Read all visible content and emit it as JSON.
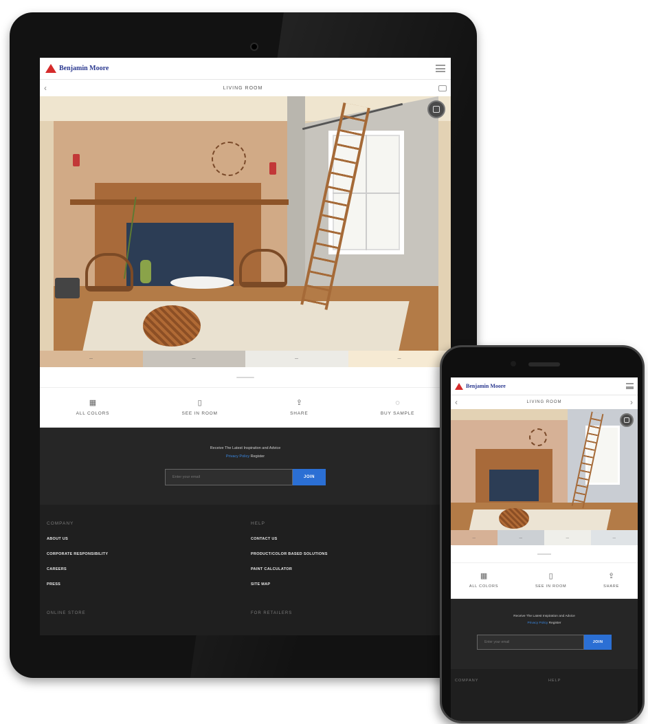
{
  "brand": {
    "name": "Benjamin Moore",
    "logo_color": "#d52b2b",
    "text_color": "#2b3990"
  },
  "tablet": {
    "page_title": "LIVING ROOM",
    "swatches": [
      {
        "label": "—",
        "color": "#d9b896"
      },
      {
        "label": "—",
        "color": "#c8c3bb"
      },
      {
        "label": "—",
        "color": "#ecebe6"
      },
      {
        "label": "—",
        "color": "#f6ead3"
      }
    ],
    "actions": [
      {
        "icon": "grid-icon",
        "glyph": "▦",
        "label": "ALL COLORS"
      },
      {
        "icon": "phone-icon",
        "glyph": "▯",
        "label": "SEE IN ROOM"
      },
      {
        "icon": "share-icon",
        "glyph": "⇪",
        "label": "SHARE"
      },
      {
        "icon": "sample-icon",
        "glyph": "◌",
        "label": "BUY SAMPLE"
      }
    ],
    "newsletter": {
      "line1": "Receive The Latest Inspiration and Advice",
      "line2_link": "Privacy Policy",
      "line2_rest": " Register",
      "placeholder": "Enter your email",
      "button": "JOIN"
    },
    "footer": {
      "col1_head": "COMPANY",
      "col1_links": [
        "ABOUT US",
        "CORPORATE RESPONSIBILITY",
        "CAREERS",
        "PRESS"
      ],
      "col1_bottom": "ONLINE STORE",
      "col2_head": "HELP",
      "col2_links": [
        "CONTACT US",
        "PRODUCT/COLOR BASED SOLUTIONS",
        "PAINT CALCULATOR",
        "SITE MAP"
      ],
      "col2_bottom": "FOR RETAILERS"
    }
  },
  "phone": {
    "page_title": "LIVING ROOM",
    "swatches": [
      {
        "label": "—",
        "color": "#d6b196"
      },
      {
        "label": "—",
        "color": "#ccd0d4"
      },
      {
        "label": "—",
        "color": "#efefea"
      },
      {
        "label": "—",
        "color": "#dfe3e6"
      }
    ],
    "actions": [
      {
        "icon": "grid-icon",
        "glyph": "▦",
        "label": "ALL COLORS"
      },
      {
        "icon": "phone-icon",
        "glyph": "▯",
        "label": "SEE IN ROOM"
      },
      {
        "icon": "share-icon",
        "glyph": "⇪",
        "label": "SHARE"
      }
    ],
    "newsletter": {
      "line1": "Receive The Latest Inspiration and Advice",
      "line2_link": "Privacy Policy",
      "line2_rest": " Register",
      "placeholder": "Enter your email",
      "button": "JOIN"
    },
    "footer": {
      "col1_head": "COMPANY",
      "col2_head": "HELP"
    }
  }
}
